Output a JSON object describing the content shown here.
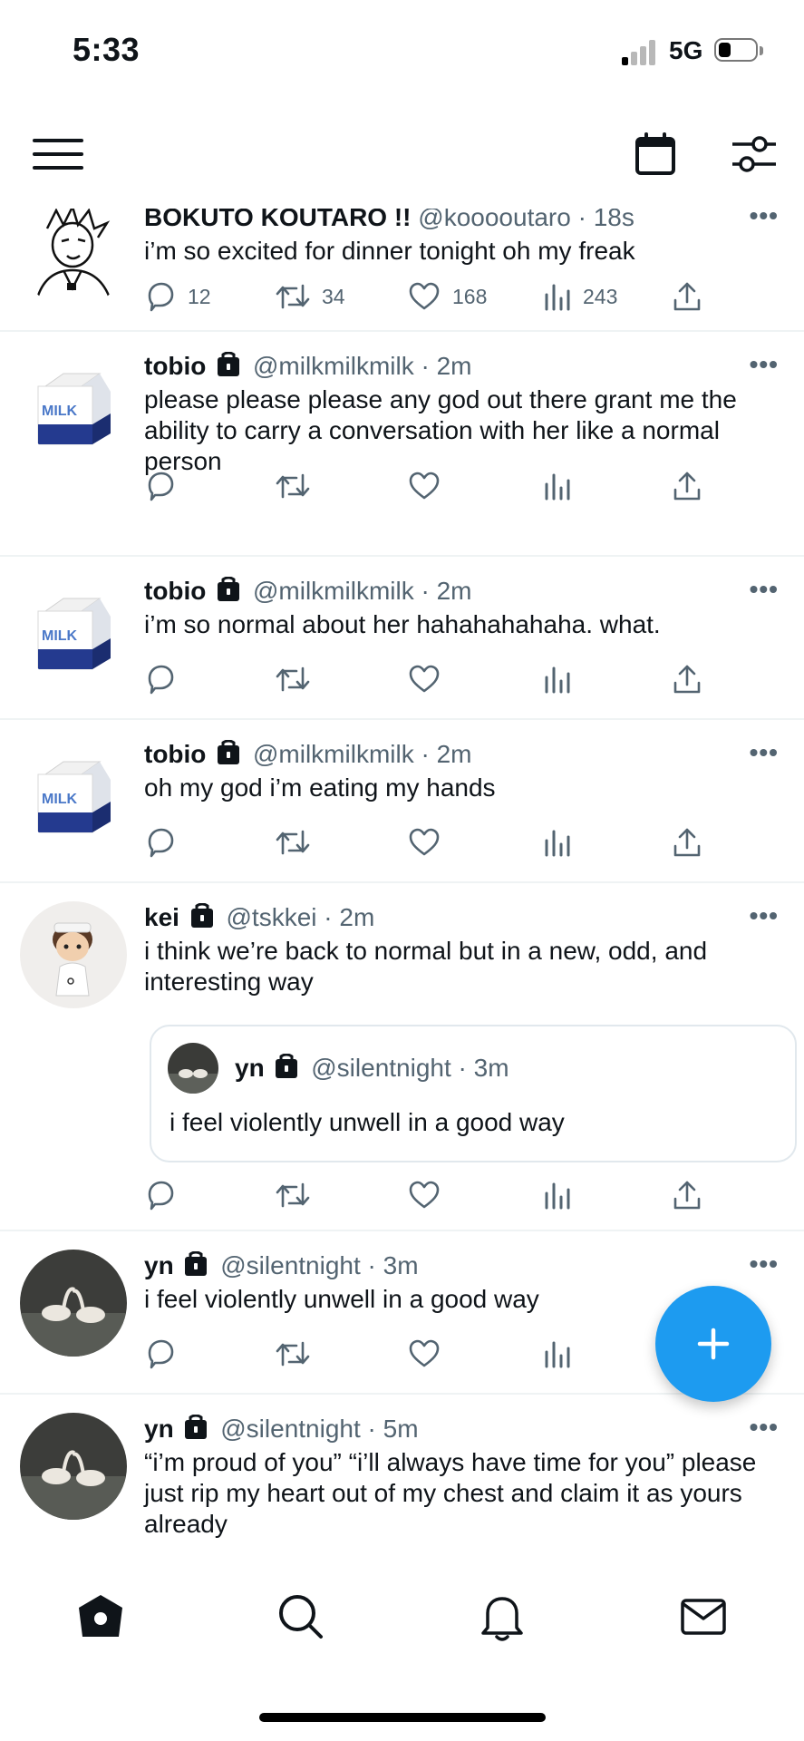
{
  "status_bar": {
    "time": "5:33",
    "network": "5G",
    "battery_level": 0.35,
    "signal_bars_active": 1
  },
  "colors": {
    "accent": "#1d9bf0",
    "secondary_text": "#536471",
    "divider": "#eff3f4"
  },
  "header": {
    "menu_icon": "hamburger-menu-icon",
    "calendar_icon": "calendar-icon",
    "filter_icon": "sliders-icon"
  },
  "tweets": [
    {
      "name": "BOKUTO KOUTARO !!",
      "handle": "@kooooutaro",
      "time": "18s",
      "text": "i’m so excited for dinner tonight oh my freak",
      "locked": false,
      "replies": "12",
      "retweets": "34",
      "likes": "168",
      "views": "243"
    },
    {
      "name": "tobio",
      "handle": "@milkmilkmilk",
      "time": "2m",
      "text": "please please please any god out there grant me the ability to carry a conversation with her like a normal person",
      "locked": true
    },
    {
      "name": "tobio",
      "handle": "@milkmilkmilk",
      "time": "2m",
      "text": "i’m so normal about her hahahahahaha. what.",
      "locked": true
    },
    {
      "name": "tobio",
      "handle": "@milkmilkmilk",
      "time": "2m",
      "text": "oh my god i’m eating my hands",
      "locked": true
    },
    {
      "name": "kei",
      "handle": "@tskkei",
      "time": "2m",
      "text": "i think we’re back to normal but in a new, odd, and interesting way",
      "locked": true,
      "quote": {
        "name": "yn",
        "handle": "@silentnight",
        "time": "3m",
        "text": "i feel violently unwell in a good way"
      }
    },
    {
      "name": "yn",
      "handle": "@silentnight",
      "time": "3m",
      "text": "i feel violently unwell in a good way",
      "locked": true
    },
    {
      "name": "yn",
      "handle": "@silentnight",
      "time": "5m",
      "text": "“i’m proud of you” “i’ll always have time for you” please just rip my heart out of my chest and claim it as yours already",
      "locked": true
    }
  ],
  "separator": "·",
  "more_label": "•••",
  "milk_label": "MILK",
  "fab": {
    "icon": "plus-icon"
  },
  "bottom_nav": [
    {
      "icon": "home-icon",
      "active": true
    },
    {
      "icon": "search-icon",
      "active": false
    },
    {
      "icon": "bell-icon",
      "active": false
    },
    {
      "icon": "mail-icon",
      "active": false
    }
  ]
}
